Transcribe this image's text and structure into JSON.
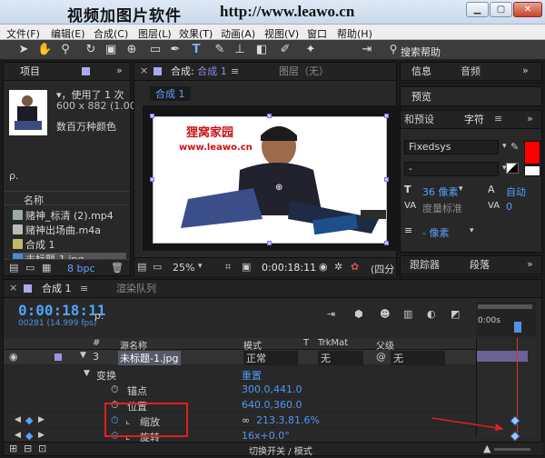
{
  "titlebar": {
    "title": "视频加图片软件",
    "url": "http://www.leawo.cn",
    "minimize": "▁",
    "maximize": "▢",
    "close": "✕"
  },
  "menu": [
    "文件(F)",
    "编辑(E)",
    "合成(C)",
    "图层(L)",
    "效果(T)",
    "动画(A)",
    "视图(V)",
    "窗口",
    "帮助(H)"
  ],
  "toolbar": {
    "search_help": "搜索帮助"
  },
  "project": {
    "tabs": [
      "项目"
    ],
    "used": "▾，使用了 1 次",
    "dims": "600 x 882 (1.00)",
    "colors": "数百万种颜色",
    "search_placeholder": "ρ.",
    "col_name": "名称",
    "items": [
      "赌神_标清 (2).mp4",
      "赌神出场曲.m4a",
      "合成 1",
      "未标题-1.jpg"
    ],
    "bpc": "8 bpc"
  },
  "composition": {
    "tab": "合成 1",
    "layer_tab": "图层（无）",
    "comp_chip": "合成 1",
    "watermark_cn": "狸窝家园",
    "watermark_url": "www.leawo.cn",
    "zoom": "25%",
    "timecode": "0:00:18:11",
    "quality": "(四分"
  },
  "info_panel": {
    "tabs": [
      "信息",
      "音频"
    ],
    "preview_tab": "预览",
    "effects_tab": "和预设",
    "character_tab": "字符",
    "paragraph_tab": "段落",
    "tracker_tab": "跟踪器",
    "font": "Fixedsys",
    "font_style": "-",
    "size": "36 像素",
    "leading_auto": "自动",
    "kerning": "度量标准",
    "tracking": "0",
    "stroke": "- 像素",
    "fill_color": "#ff0000"
  },
  "timeline": {
    "tab": "合成 1",
    "render_tab": "渲染队列",
    "timecode": "0:00:18:11",
    "fps": "00281 (14.999 fps)",
    "columns": {
      "num": "#",
      "source": "源名称",
      "mode": "模式",
      "t": "T",
      "trkmat": "TrkMat",
      "parent": "父级"
    },
    "layer": {
      "num": "3",
      "name": "未标题-1.jpg",
      "mode": "正常",
      "trkmat": "无",
      "parent": "无"
    },
    "transform": {
      "label": "变换",
      "reset": "重置"
    },
    "props": [
      {
        "name": "锚点",
        "value": "300.0,441.0"
      },
      {
        "name": "位置",
        "value": "640.0,360.0"
      },
      {
        "name": "缩放",
        "value": "213.3,81.6%"
      },
      {
        "name": "旋转",
        "value": "16x+0.0°"
      }
    ],
    "ruler_label": "0:00s",
    "footer": "切换开关 / 模式"
  }
}
